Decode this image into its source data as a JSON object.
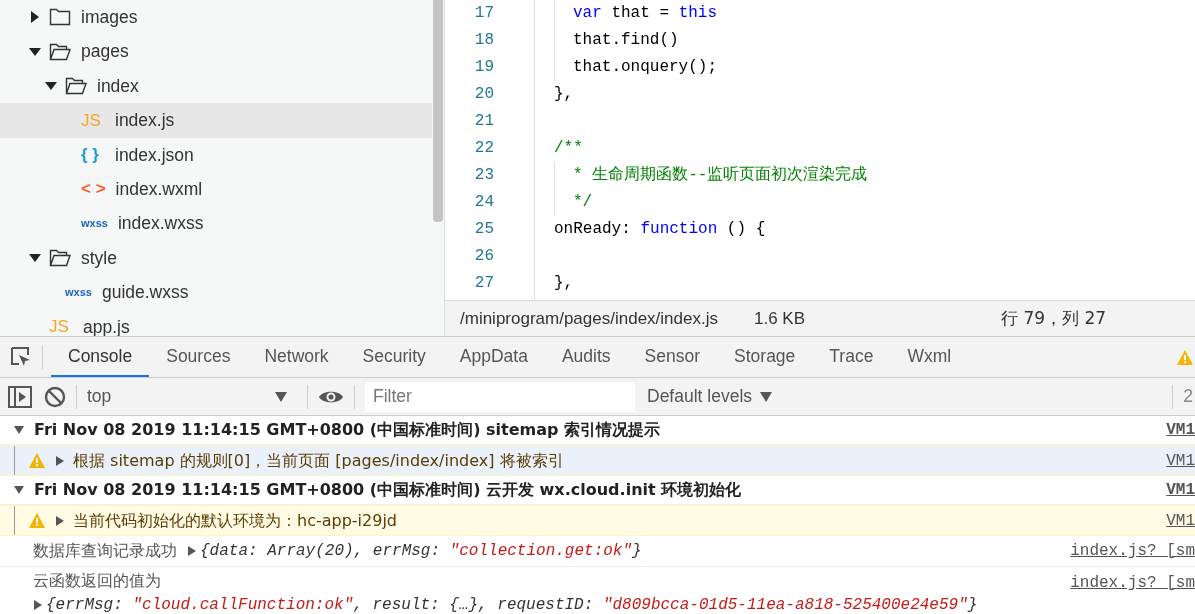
{
  "file_tree": [
    {
      "name": "images",
      "kind": "folder",
      "expanded": false,
      "selected": false
    },
    {
      "name": "pages",
      "kind": "folder",
      "expanded": true,
      "selected": false,
      "children": [
        {
          "name": "index",
          "kind": "folder",
          "expanded": true,
          "selected": false,
          "children": [
            {
              "name": "index.js",
              "kind": "js",
              "icon": "JS",
              "selected": true
            },
            {
              "name": "index.json",
              "kind": "json",
              "icon": "{ }",
              "selected": false
            },
            {
              "name": "index.wxml",
              "kind": "wxml",
              "icon": "< >",
              "selected": false
            },
            {
              "name": "index.wxss",
              "kind": "wxss",
              "icon": "wxss",
              "selected": false
            }
          ]
        }
      ]
    },
    {
      "name": "style",
      "kind": "folder",
      "expanded": true,
      "selected": false,
      "children": [
        {
          "name": "guide.wxss",
          "kind": "wxss",
          "icon": "wxss",
          "selected": false
        }
      ]
    },
    {
      "name": "app.js",
      "kind": "js",
      "icon": "JS",
      "selected": false
    }
  ],
  "editor": {
    "lines": [
      {
        "number": "17",
        "guide": true,
        "tokens": [
          {
            "kind": "keyword",
            "text": "var"
          },
          {
            "kind": "plain",
            "text": " that = "
          },
          {
            "kind": "keyword",
            "text": "this"
          }
        ]
      },
      {
        "number": "18",
        "guide": true,
        "tokens": [
          {
            "kind": "plain",
            "text": "that.find()"
          }
        ]
      },
      {
        "number": "19",
        "guide": true,
        "tokens": [
          {
            "kind": "plain",
            "text": "that.onquery();"
          }
        ]
      },
      {
        "number": "20",
        "guide": false,
        "tokens": [
          {
            "kind": "plain",
            "text": "},"
          }
        ]
      },
      {
        "number": "21",
        "guide": false
      },
      {
        "number": "22",
        "guide": false,
        "tokens": [
          {
            "kind": "comment",
            "text": "/**"
          }
        ]
      },
      {
        "number": "23",
        "guide": true,
        "tokens": [
          {
            "kind": "comment",
            "text": "* 生命周期函数--监听页面初次渲染完成"
          }
        ]
      },
      {
        "number": "24",
        "guide": true,
        "tokens": [
          {
            "kind": "comment",
            "text": "*/"
          }
        ]
      },
      {
        "number": "25",
        "guide": false,
        "tokens": [
          {
            "kind": "plain",
            "text": "onReady: "
          },
          {
            "kind": "keyword",
            "text": "function"
          },
          {
            "kind": "plain",
            "text": " () {"
          }
        ]
      },
      {
        "number": "26",
        "guide": false
      },
      {
        "number": "27",
        "guide": false,
        "tokens": [
          {
            "kind": "plain",
            "text": "},"
          }
        ]
      }
    ],
    "status_bar": {
      "path": "/miniprogram/pages/index/index.js",
      "size": "1.6 KB",
      "cursor": "行 79，列 27"
    }
  },
  "devtools": {
    "tabs": [
      {
        "label": "Console",
        "selected": true
      },
      {
        "label": "Sources",
        "selected": false
      },
      {
        "label": "Network",
        "selected": false
      },
      {
        "label": "Security",
        "selected": false
      },
      {
        "label": "AppData",
        "selected": false
      },
      {
        "label": "Audits",
        "selected": false
      },
      {
        "label": "Sensor",
        "selected": false
      },
      {
        "label": "Storage",
        "selected": false
      },
      {
        "label": "Trace",
        "selected": false
      },
      {
        "label": "Wxml",
        "selected": false
      }
    ],
    "toolbar": {
      "context": "top",
      "filter_placeholder": "Filter",
      "levels": "Default levels",
      "issue_count": "2"
    },
    "console": [
      {
        "kind": "group",
        "expanded": true,
        "text": "Fri Nov 08 2019 11:14:15 GMT+0800 (中国标准时间) sitemap 索引情况提示",
        "source": "VM1",
        "children": [
          {
            "kind": "warning",
            "selected": true,
            "text": "根据 sitemap 的规则[0]，当前页面 [pages/index/index] 将被索引",
            "source": "VM1"
          }
        ]
      },
      {
        "kind": "group",
        "expanded": true,
        "text": "Fri Nov 08 2019 11:14:15 GMT+0800 (中国标准时间) 云开发 wx.cloud.init 环境初始化",
        "source": "VM1",
        "children": [
          {
            "kind": "warning",
            "selected": false,
            "text": "当前代码初始化的默认环境为：hc-app-i29jd",
            "source": "VM1"
          }
        ]
      },
      {
        "kind": "log",
        "message": "数据库查询记录成功",
        "inline": true,
        "object": [
          {
            "kind": "plain",
            "text": "{data: Array(20), errMsg: "
          },
          {
            "kind": "string",
            "text": "\"collection.get:ok\""
          },
          {
            "kind": "plain",
            "text": "}"
          }
        ],
        "source": "index.js? [sm"
      },
      {
        "kind": "log",
        "message": "云函数返回的值为",
        "inline": false,
        "object": [
          {
            "kind": "plain",
            "text": "{errMsg: "
          },
          {
            "kind": "string",
            "text": "\"cloud.callFunction:ok\""
          },
          {
            "kind": "plain",
            "text": ", result: {…}, requestID: "
          },
          {
            "kind": "string",
            "text": "\"d809bcca-01d5-11ea-a818-525400e24e59\""
          },
          {
            "kind": "plain",
            "text": "}"
          }
        ],
        "source": "index.js? [sm"
      }
    ]
  }
}
